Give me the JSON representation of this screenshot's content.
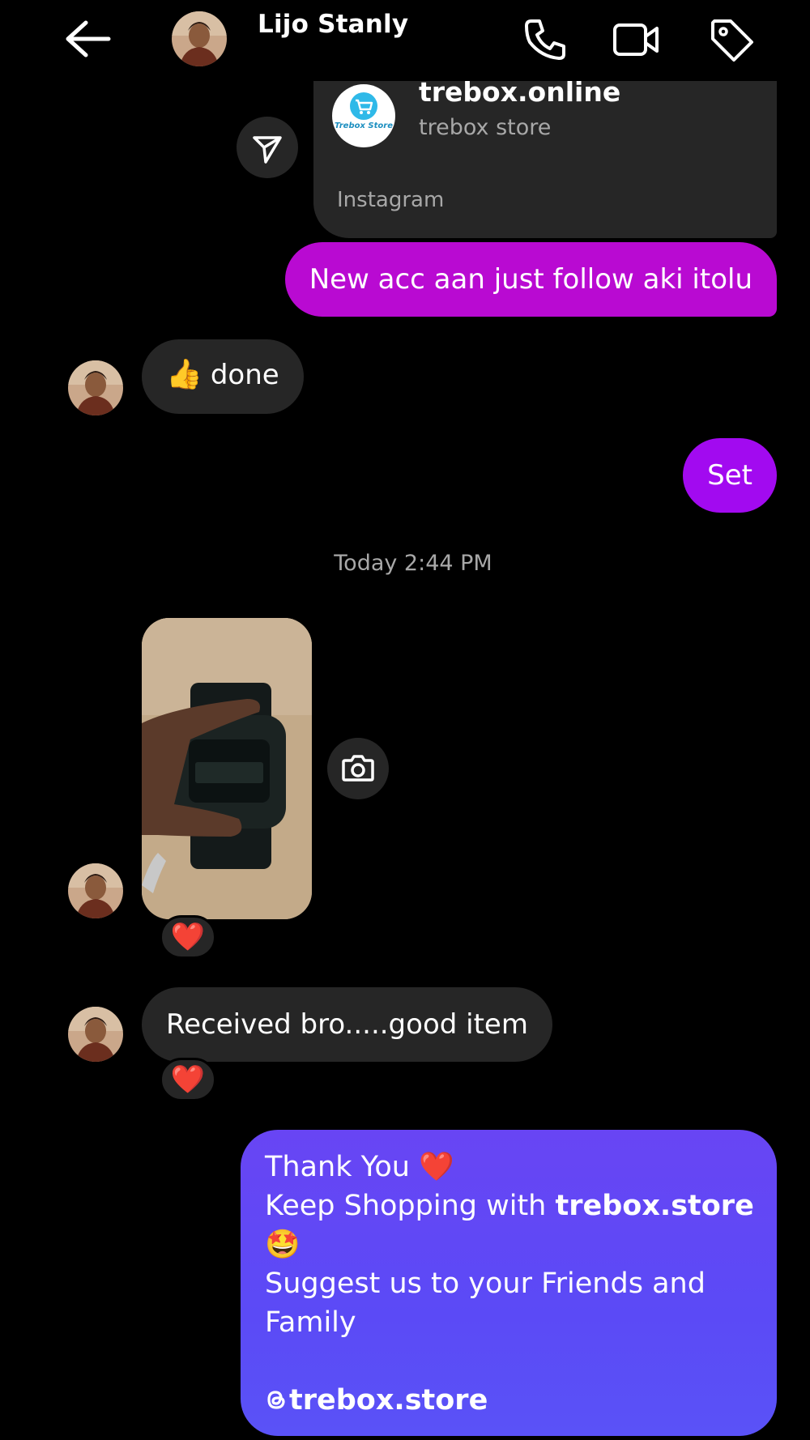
{
  "header": {
    "contact_name": "Lijo Stanly",
    "icons": [
      "back-arrow-icon",
      "phone-icon",
      "video-camera-icon",
      "tag-icon"
    ]
  },
  "link_card": {
    "title": "trebox.online",
    "subtitle": "trebox store",
    "source": "Instagram",
    "logo_text": "Trebox Store"
  },
  "messages": {
    "out_1": "New acc aan just follow aki itolu",
    "in_1_emoji": "👍",
    "in_1_text": "done",
    "out_2": "Set",
    "timestamp": "Today 2:44 PM",
    "photo_reaction": "❤️",
    "in_2": "Received bro.....good item",
    "in_2_reaction": "❤️",
    "out_3": {
      "line1": "Thank You ❤️",
      "line2_prefix": " Keep Shopping with ",
      "line2_bold": "trebox.store",
      "line3": "🤩",
      "line4": "Suggest us to your Friends and",
      "line5": "Family",
      "handle": "trebox.store"
    }
  },
  "colors": {
    "background": "#000000",
    "incoming_bubble": "#262626",
    "outgoing_magenta": "#b90ad2",
    "outgoing_purple": "#a20af0",
    "outgoing_blue": "#5b4af6",
    "muted_text": "#a8a8a8"
  }
}
